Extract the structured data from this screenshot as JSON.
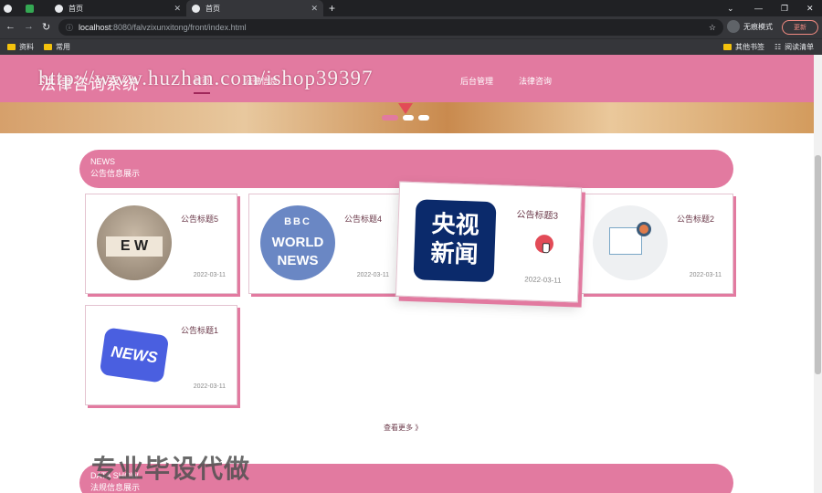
{
  "browser": {
    "tabs": [
      {
        "label": ""
      },
      {
        "label": ""
      },
      {
        "label": "首页"
      },
      {
        "label": "首页"
      }
    ],
    "url_host": "localhost",
    "url_path": ":8080/falvzixunxitong/front/index.html",
    "profile_label": "无痕模式",
    "update_label": "更新",
    "bookmarks": [
      "资料",
      "常用"
    ],
    "bookmarks_right": [
      "其他书签",
      "阅读清单"
    ]
  },
  "site": {
    "logo": "法律咨询系统",
    "nav": [
      "首页",
      "法律信息",
      "后台管理",
      "法律咨询"
    ],
    "watermark": "http://www.huzhan.com/ishop39397"
  },
  "news": {
    "head_en": "NEWS",
    "head_cn": "公告信息展示",
    "items": [
      {
        "title": "公告标题5",
        "date": "2022-03-11",
        "icon": "ew-blocks-image"
      },
      {
        "title": "公告标题4",
        "date": "2022-03-11",
        "icon": "bbc-world-news-image"
      },
      {
        "title": "公告标题3",
        "date": "2022-03-11",
        "icon": "cctv-news-image"
      },
      {
        "title": "公告标题2",
        "date": "2022-03-11",
        "icon": "newspaper-image"
      },
      {
        "title": "公告标题1",
        "date": "2022-03-11",
        "icon": "news-3d-image"
      }
    ],
    "more": "查看更多 》"
  },
  "law": {
    "head_en": "DATA SHOW",
    "head_cn": "法规信息展示"
  },
  "overlay_text": "专业毕设代做",
  "thumb_texts": {
    "ew": "E W",
    "bbc_top": "BBC",
    "bbc_mid": "WORLD",
    "bbc_bot": "NEWS",
    "cctv": "央视新闻",
    "news": "NEWS"
  }
}
